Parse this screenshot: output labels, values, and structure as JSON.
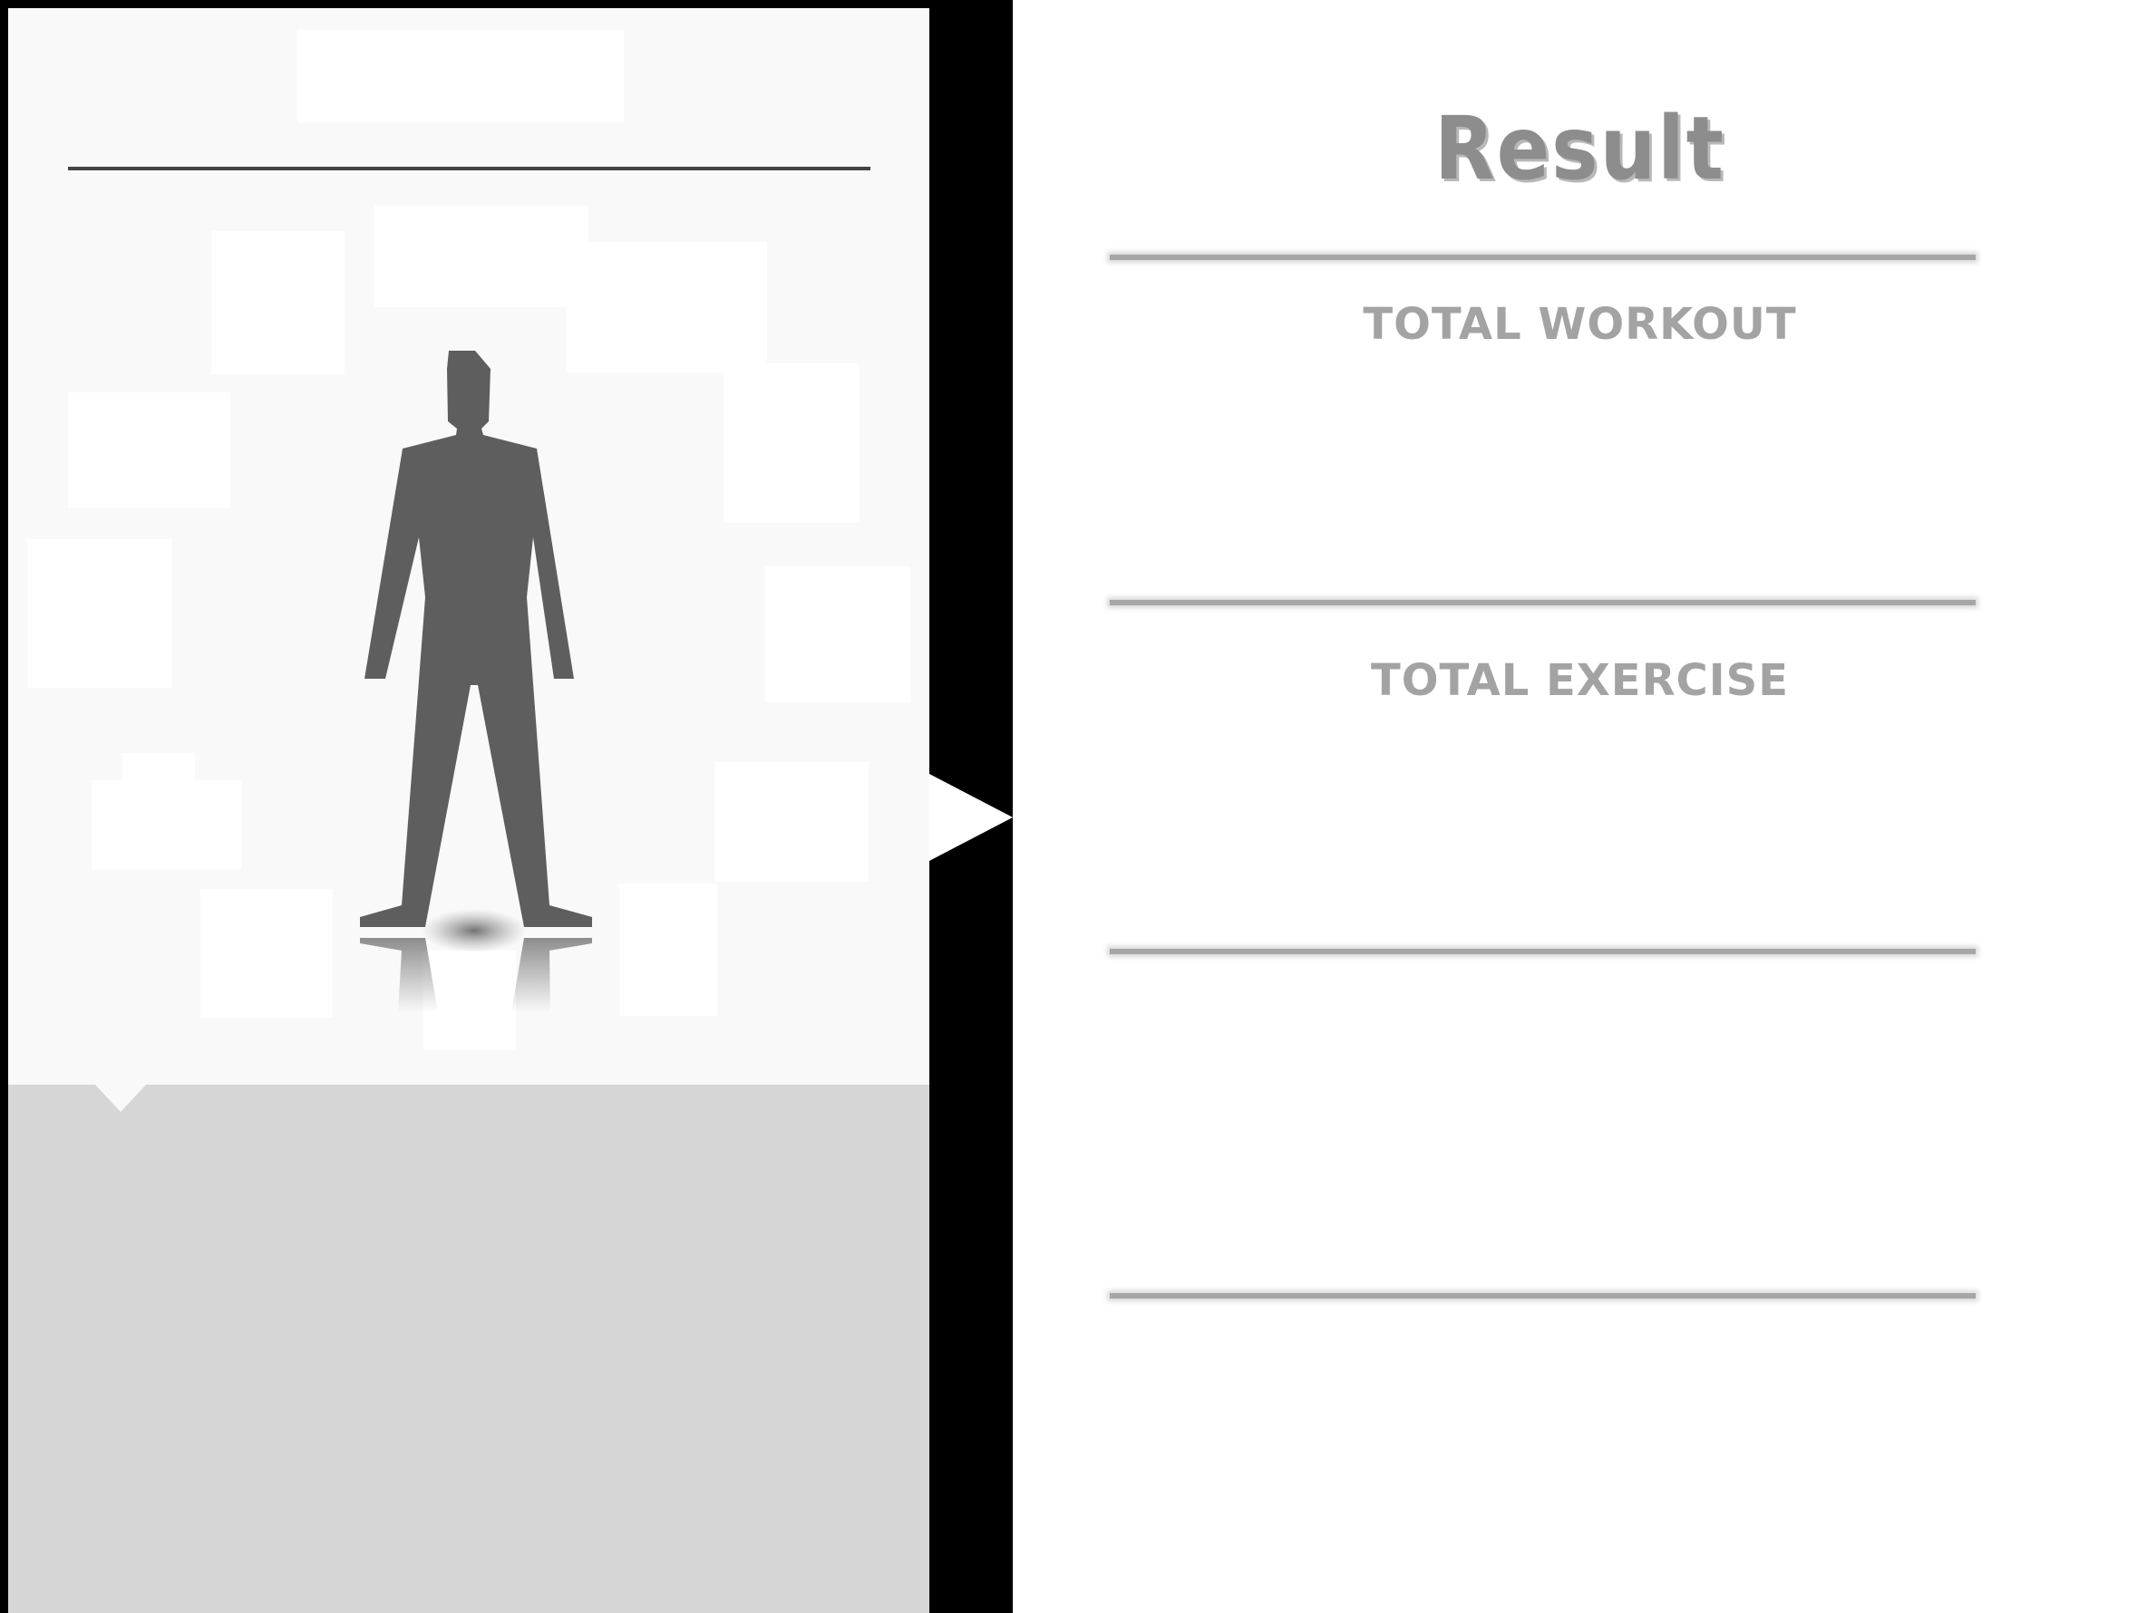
{
  "result_panel": {
    "title": "Result",
    "sections": [
      {
        "label": "TOTAL WORKOUT"
      },
      {
        "label": "TOTAL EXERCISE"
      }
    ]
  },
  "colors": {
    "figure": "#5e5e5e",
    "panel_bottom": "#d6d6d6",
    "label_gray": "#a3a3a3"
  },
  "icons": {
    "body_figure": "human-silhouette-icon"
  }
}
